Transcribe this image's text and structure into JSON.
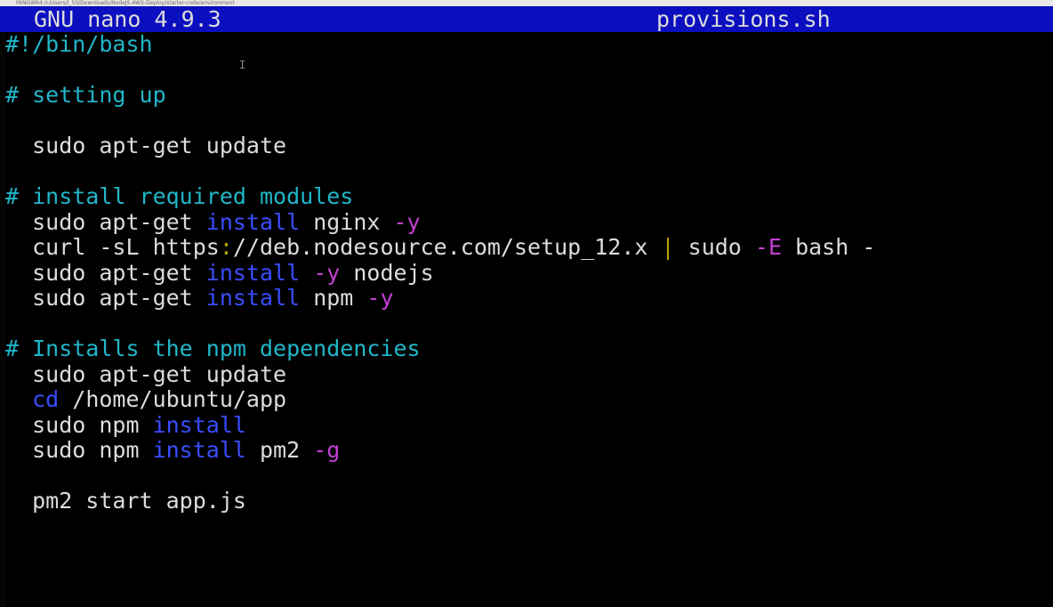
{
  "window": {
    "path": "MINGW64:/c/Users/l_50/Downloads/NodeJS-AWS-Deploy/starter-code/environment"
  },
  "nano": {
    "version": "GNU nano 4.9.3",
    "filename": "provisions.sh"
  },
  "colors": {
    "titlebar_bg": "#0b0fbf",
    "comment": "#21b6c9",
    "keyword": "#3a4dff",
    "flag": "#c33fd0",
    "pipe": "#b3a400",
    "text": "#dcdcdc",
    "background": "#000000"
  },
  "lines": [
    [
      {
        "t": "#!/bin/bash",
        "c": "comment"
      }
    ],
    [],
    [
      {
        "t": "# setting up",
        "c": "comment"
      }
    ],
    [],
    [
      {
        "t": "  sudo apt-get update",
        "c": "plain"
      }
    ],
    [],
    [
      {
        "t": "# install required modules",
        "c": "comment"
      }
    ],
    [
      {
        "t": "  sudo apt-get ",
        "c": "plain"
      },
      {
        "t": "install",
        "c": "keyword"
      },
      {
        "t": " nginx ",
        "c": "plain"
      },
      {
        "t": "-y",
        "c": "flag"
      }
    ],
    [
      {
        "t": "  curl -sL https",
        "c": "plain"
      },
      {
        "t": ":",
        "c": "pipe"
      },
      {
        "t": "//deb.nodesource.com/setup_12.x ",
        "c": "plain"
      },
      {
        "t": "|",
        "c": "pipe"
      },
      {
        "t": " sudo ",
        "c": "plain"
      },
      {
        "t": "-E",
        "c": "flag"
      },
      {
        "t": " bash -",
        "c": "plain"
      }
    ],
    [
      {
        "t": "  sudo apt-get ",
        "c": "plain"
      },
      {
        "t": "install",
        "c": "keyword"
      },
      {
        "t": " ",
        "c": "plain"
      },
      {
        "t": "-y",
        "c": "flag"
      },
      {
        "t": " nodejs",
        "c": "plain"
      }
    ],
    [
      {
        "t": "  sudo apt-get ",
        "c": "plain"
      },
      {
        "t": "install",
        "c": "keyword"
      },
      {
        "t": " npm ",
        "c": "plain"
      },
      {
        "t": "-y",
        "c": "flag"
      }
    ],
    [],
    [
      {
        "t": "# Installs the npm dependencies",
        "c": "comment"
      }
    ],
    [
      {
        "t": "  sudo apt-get update",
        "c": "plain"
      }
    ],
    [
      {
        "t": "  ",
        "c": "plain"
      },
      {
        "t": "cd",
        "c": "keyword"
      },
      {
        "t": " /home/ubuntu/app",
        "c": "plain"
      }
    ],
    [
      {
        "t": "  sudo npm ",
        "c": "plain"
      },
      {
        "t": "install",
        "c": "keyword"
      }
    ],
    [
      {
        "t": "  sudo npm ",
        "c": "plain"
      },
      {
        "t": "install",
        "c": "keyword"
      },
      {
        "t": " pm2 ",
        "c": "plain"
      },
      {
        "t": "-g",
        "c": "flag"
      }
    ],
    [],
    [
      {
        "t": "  pm2 start app.js",
        "c": "plain"
      }
    ]
  ]
}
